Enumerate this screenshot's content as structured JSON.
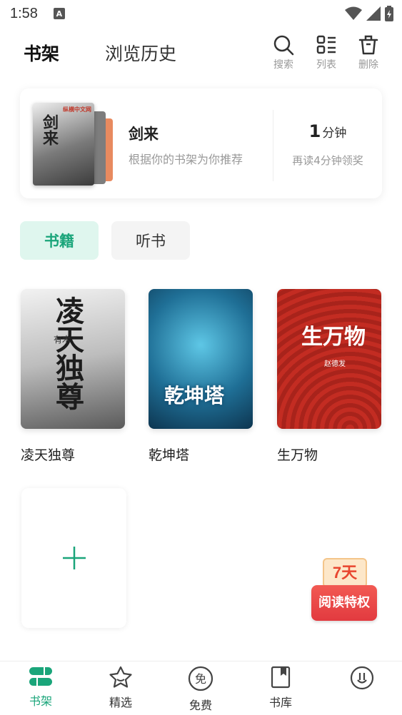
{
  "status_bar": {
    "time": "1:58",
    "badge": "A"
  },
  "header": {
    "tabs": [
      {
        "label": "书架",
        "active": true
      },
      {
        "label": "浏览历史",
        "active": false
      }
    ],
    "tools": [
      {
        "icon": "search-icon",
        "label": "搜索"
      },
      {
        "icon": "list-icon",
        "label": "列表"
      },
      {
        "icon": "trash-icon",
        "label": "删除"
      }
    ]
  },
  "recommend": {
    "cover_logo": "纵横中文网",
    "cover_title": "剑来",
    "title": "剑来",
    "subtitle": "根据你的书架为你推荐",
    "minutes": "1",
    "minutes_unit": "分钟",
    "reward_text": "再读4分钟领奖"
  },
  "segments": [
    {
      "label": "书籍",
      "active": true
    },
    {
      "label": "听书",
      "active": false
    }
  ],
  "books": [
    {
      "title": "凌天独尊",
      "cover_text": "凌天独尊",
      "cover_author": "有木",
      "bg": "#d9d9d9"
    },
    {
      "title": "乾坤塔",
      "cover_text": "乾坤塔",
      "cover_author": "",
      "bg": "#1f5f84"
    },
    {
      "title": "生万物",
      "cover_text": "生万物",
      "cover_author": "赵德发",
      "bg": "#b8271f"
    }
  ],
  "promo": {
    "top_text": "7天",
    "bottom_text": "阅读特权"
  },
  "bottom_nav": [
    {
      "label": "书架",
      "icon": "bookshelf-icon",
      "active": true
    },
    {
      "label": "精选",
      "icon": "star-icon",
      "active": false
    },
    {
      "label": "免费",
      "icon": "free-icon",
      "active": false
    },
    {
      "label": "书库",
      "icon": "library-icon",
      "active": false
    },
    {
      "label": "",
      "icon": "profile-icon",
      "active": false
    }
  ],
  "colors": {
    "accent": "#1aa57a",
    "accent_bg": "#dff6ee",
    "promo_red": "#e23a3f"
  }
}
